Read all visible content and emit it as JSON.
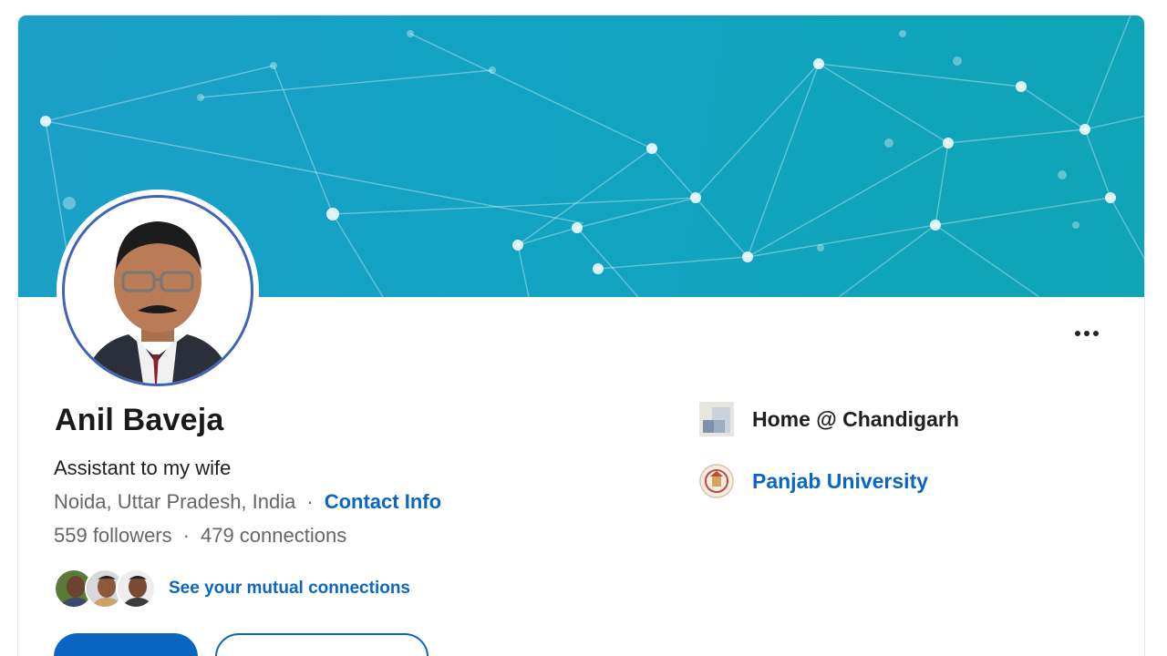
{
  "profile": {
    "name": "Anil Baveja",
    "headline": "Assistant to my wife",
    "location": "Noida, Uttar Pradesh, India",
    "separator": "·",
    "contact_label": "Contact Info",
    "followers": "559 followers",
    "connections": "479 connections"
  },
  "mutual": {
    "link_label": "See your mutual connections",
    "avatars": [
      "mutual-connection-1",
      "mutual-connection-2",
      "mutual-connection-3"
    ]
  },
  "sidebar": {
    "company": {
      "name": "Home @ Chandigarh",
      "icon": "company-logo-icon"
    },
    "school": {
      "name": "Panjab University",
      "icon": "university-seal-icon"
    }
  },
  "menu": {
    "icon": "more-options-icon"
  },
  "colors": {
    "banner_start": "#1b9fc7",
    "banner_end": "#0fa4b6",
    "link": "#0a66c2",
    "avatar_ring": "#3f63b8"
  }
}
